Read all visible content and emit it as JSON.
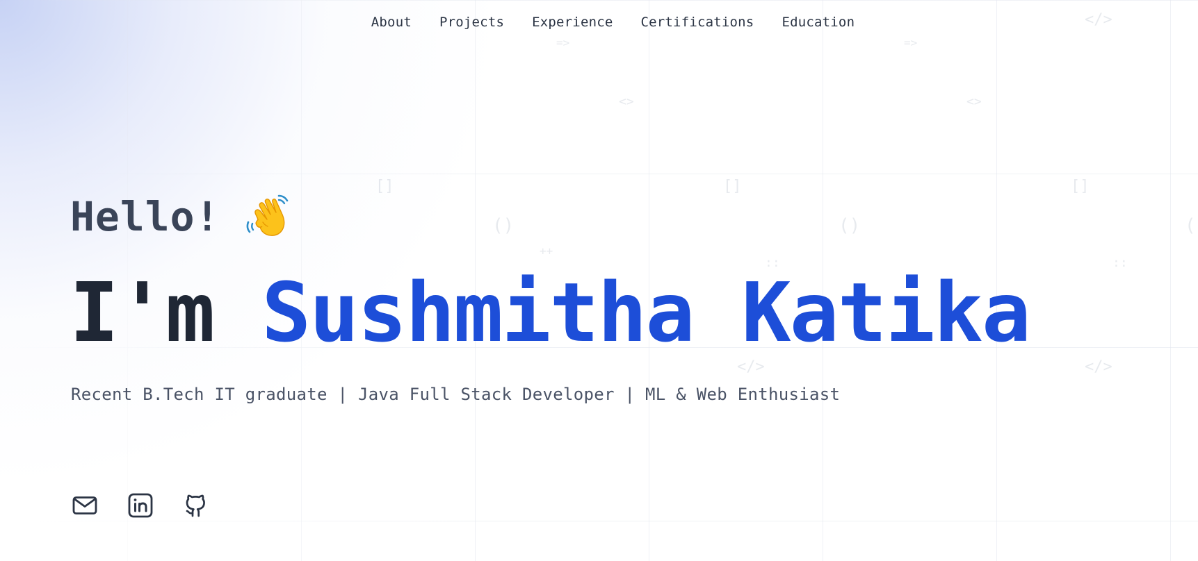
{
  "nav": {
    "items": [
      {
        "label": "About"
      },
      {
        "label": "Projects"
      },
      {
        "label": "Experience"
      },
      {
        "label": "Certifications"
      },
      {
        "label": "Education"
      }
    ]
  },
  "hero": {
    "greeting": "Hello!",
    "greeting_icon": "waving-hand-icon",
    "headline_prefix": "I'm",
    "headline_name": "Sushmitha Katika",
    "subtitle": "Recent B.Tech IT graduate | Java Full Stack Developer | ML & Web Enthusiast"
  },
  "socials": [
    {
      "icon": "mail-icon"
    },
    {
      "icon": "linkedin-icon"
    },
    {
      "icon": "github-icon"
    }
  ],
  "background_glyphs": [
    "</>",
    "=>",
    "<>",
    "[]",
    "()",
    "::",
    "++",
    "</>",
    "=>",
    "<>",
    "[]",
    "()",
    "::",
    "</>",
    "[]",
    "()"
  ],
  "colors": {
    "accent": "#1d4ed8",
    "heading": "#1f2735",
    "text": "#4a5366",
    "nav": "#2b3444",
    "gradient": "#c4d0f4"
  }
}
